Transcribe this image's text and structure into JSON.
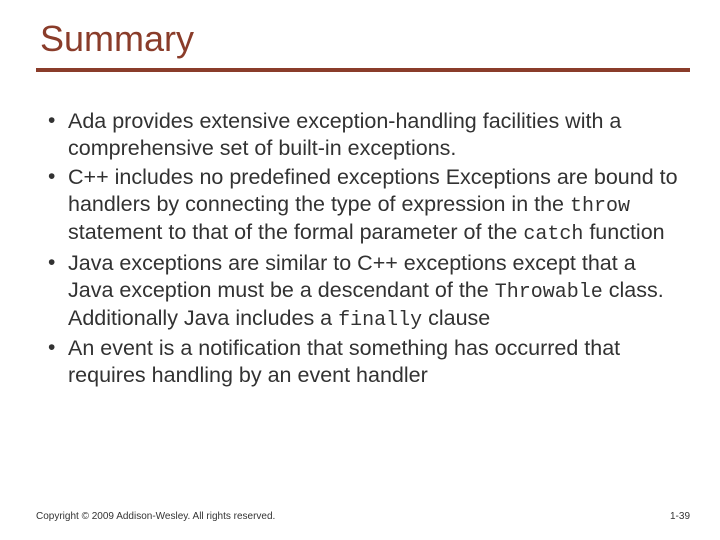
{
  "slide": {
    "title": "Summary",
    "bullets": [
      {
        "segments": [
          {
            "text": "Ada provides extensive exception-handling facilities with a comprehensive set of built-in exceptions.",
            "mono": false
          }
        ]
      },
      {
        "segments": [
          {
            "text": "C++ includes no predefined exceptions Exceptions are bound to handlers by connecting the type of expression in the ",
            "mono": false
          },
          {
            "text": "throw",
            "mono": true
          },
          {
            "text": " statement to that of the formal parameter of the ",
            "mono": false
          },
          {
            "text": "catch",
            "mono": true
          },
          {
            "text": " function",
            "mono": false
          }
        ]
      },
      {
        "segments": [
          {
            "text": "Java exceptions are similar to C++ exceptions except that a Java exception must be a descendant of the ",
            "mono": false
          },
          {
            "text": "Throwable",
            "mono": true
          },
          {
            "text": " class.  Additionally Java includes a ",
            "mono": false
          },
          {
            "text": "finally",
            "mono": true
          },
          {
            "text": " clause",
            "mono": false
          }
        ]
      },
      {
        "segments": [
          {
            "text": "An event is a notification that something has occurred that requires handling by an event handler",
            "mono": false
          }
        ]
      }
    ],
    "footer": {
      "copyright": "Copyright © 2009 Addison-Wesley. All rights reserved.",
      "pagenum": "1-39"
    }
  }
}
